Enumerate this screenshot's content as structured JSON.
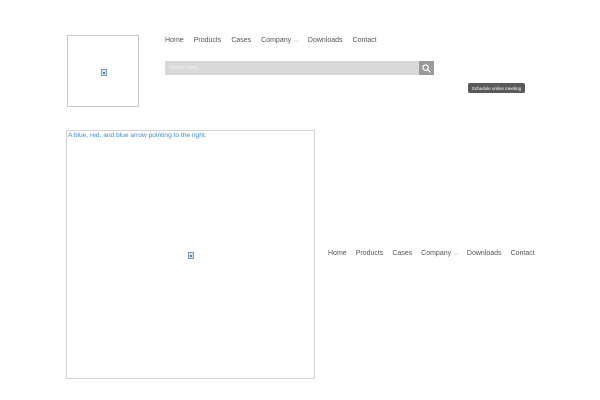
{
  "nav_items": [
    {
      "label": "Home"
    },
    {
      "label": "Products"
    },
    {
      "label": "Cases"
    },
    {
      "label": "Company",
      "has_dropdown": true
    },
    {
      "label": "Downloads"
    },
    {
      "label": "Contact"
    }
  ],
  "search": {
    "placeholder": "Search here..."
  },
  "meeting_button": {
    "label": "Schedule online meeting"
  },
  "hero_image": {
    "alt_text": "A blue, red, and blue arrow pointing to the right."
  },
  "colors": {
    "search_bg": "#d9d9d9",
    "search_button": "#9a9a9a",
    "meeting_button_bg": "#5a5a5a",
    "alt_text": "#3d8ed0"
  }
}
